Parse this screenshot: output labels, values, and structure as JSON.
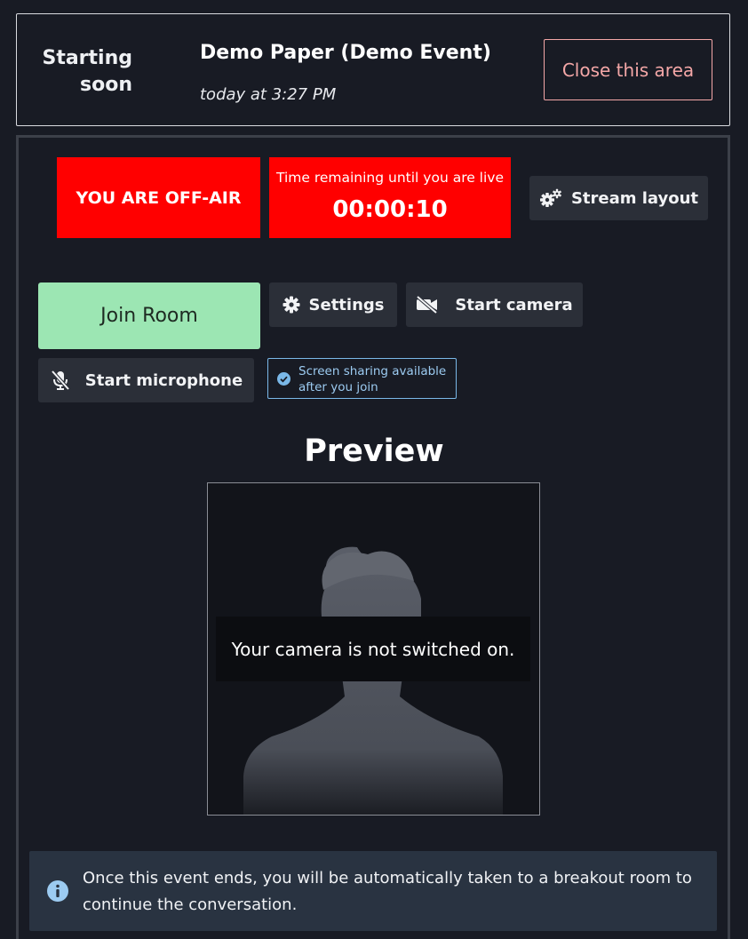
{
  "header": {
    "status": "Starting soon",
    "event_title": "Demo Paper (Demo Event)",
    "event_time": "today at 3:27 PM",
    "close_label": "Close this area"
  },
  "broadcast": {
    "offair_label": "YOU ARE OFF-AIR",
    "countdown_label": "Time remaining until you are live",
    "countdown_value": "00:00:10",
    "stream_layout_label": "Stream layout"
  },
  "controls": {
    "join_room_label": "Join Room",
    "settings_label": "Settings",
    "start_camera_label": "Start camera",
    "start_microphone_label": "Start microphone",
    "screen_share_note": "Screen sharing available after you join"
  },
  "preview": {
    "title": "Preview",
    "camera_message": "Your camera is not switched on."
  },
  "info": {
    "message": "Once this event ends, you will be automatically taken to a breakout room to continue the conversation."
  },
  "icons": {
    "stream_layout": "gears-icon",
    "settings": "gear-icon",
    "start_camera": "video-off-icon",
    "start_microphone": "microphone-off-icon",
    "screen_share": "check-circle-icon",
    "info": "info-circle-icon"
  },
  "colors": {
    "background": "#181b24",
    "offair_red": "#ff0000",
    "join_green": "#9ce6b3",
    "close_accent": "#f4a7a7",
    "info_blue": "#9ccbf1",
    "button_dark": "#2b2f38",
    "info_bar": "#293341"
  }
}
